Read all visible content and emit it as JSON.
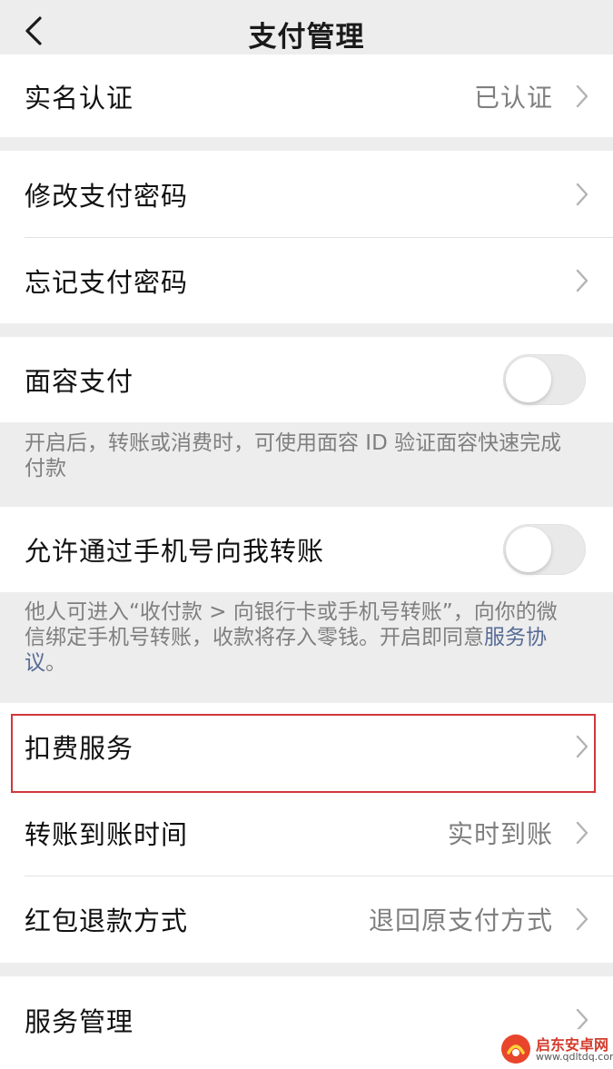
{
  "nav": {
    "title": "支付管理"
  },
  "section1": {
    "real_name_label": "实名认证",
    "real_name_value": "已认证"
  },
  "section2": {
    "change_password": "修改支付密码",
    "forgot_password": "忘记支付密码"
  },
  "section3": {
    "face_pay_label": "面容支付",
    "face_pay_on": false,
    "face_pay_note": "开启后，转账或消费时，可使用面容 ID 验证面容快速完成付款"
  },
  "section4": {
    "phone_transfer_label": "允许通过手机号向我转账",
    "phone_transfer_on": false,
    "phone_transfer_note": "他人可进入“收付款 > 向银行卡或手机号转账”，向你的微信绑定手机号转账，收款将存入零钱。开启即同意",
    "phone_transfer_link": "服务协议",
    "phone_transfer_note_end": "。"
  },
  "section5": {
    "deduction_label": "扣费服务",
    "transfer_time_label": "转账到账时间",
    "transfer_time_value": "实时到账",
    "red_packet_label": "红包退款方式",
    "red_packet_value": "退回原支付方式"
  },
  "section6": {
    "service_mgmt_label": "服务管理"
  },
  "watermark": {
    "name": "启东安卓网",
    "url": "www.qdltdq.com"
  },
  "colors": {
    "highlight": "#d0373c",
    "link": "#576b95",
    "background": "#ededed"
  }
}
